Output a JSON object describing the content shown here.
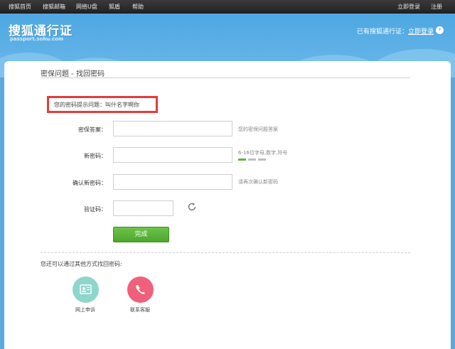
{
  "nav": {
    "items": [
      "搜狐首页",
      "搜狐邮箱",
      "网络U盘",
      "狐盾",
      "帮助"
    ],
    "right": [
      "立即登录",
      "注册"
    ]
  },
  "header": {
    "logo": "搜狐通行证",
    "domain": "passport.sohu.com",
    "has_account": "已有搜狐通行证：",
    "login_now": "立即登录"
  },
  "section": {
    "title": "密保问题 - 找回密码"
  },
  "hint": {
    "text": "您的密码提示问题：叫什名字啊你"
  },
  "form": {
    "answer_label": "密保答案：",
    "answer_tip": "您的密保问题答案",
    "new_pwd_label": "新密码：",
    "new_pwd_tip": "6-16位字母,数字,符号",
    "confirm_label": "确认新密码：",
    "confirm_tip": "请再次确认新密码",
    "captcha_label": "验证码：",
    "submit": "完成"
  },
  "alternatives": {
    "intro": "您还可以通过其他方式找回密码:",
    "online": "网上申诉",
    "contact": "联系客服"
  },
  "colors": {
    "header_blue": "#4ea7e1",
    "hint_border": "#e43b3b",
    "submit_green": "#5bb53a",
    "strength_green": "#5bb53a",
    "online_teal": "#8ed6cc",
    "contact_pink": "#f0607a"
  }
}
